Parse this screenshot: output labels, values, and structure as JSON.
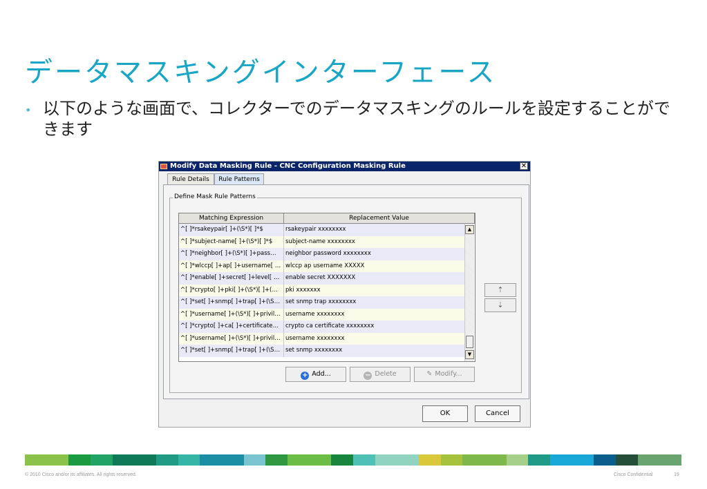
{
  "slide": {
    "title": "データマスキングインターフェース",
    "bullet_marker": "•",
    "bullet_text": "以下のような画面で、コレクターでのデータマスキングのルールを設定することができます"
  },
  "dialog": {
    "title": "Modify Data Masking Rule - CNC Configuration Masking Rule",
    "close_glyph": "✕",
    "tabs": [
      "Rule Details",
      "Rule Patterns"
    ],
    "active_tab": "Rule Patterns",
    "group_label": "Define Mask Rule Patterns",
    "columns": [
      "Matching Expression",
      "Replacement Value"
    ],
    "rows": [
      {
        "expr": "^[ ]*rsakeypair[ ]+(\\S*)[ ]*$",
        "value": "rsakeypair xxxxxxxx"
      },
      {
        "expr": "^[ ]*subject-name[ ]+(\\S*)[ ]*$",
        "value": "subject-name xxxxxxxx"
      },
      {
        "expr": "^[ ]*neighbor[ ]+(\\S*)[ ]+pass…",
        "value": "neighbor password xxxxxxxx"
      },
      {
        "expr": "^[ ]*wlccp[ ]+ap[ ]+username[ …",
        "value": "wlccp ap username XXXXX"
      },
      {
        "expr": "^[ ]*enable[ ]+secret[ ]+level[ …",
        "value": "enable secret XXXXXXX"
      },
      {
        "expr": "^[ ]*crypto[ ]+pki[ ]+(\\S*)[ ]+(…",
        "value": "pki xxxxxxx"
      },
      {
        "expr": "^[ ]*set[ ]+snmp[ ]+trap[ ]+(\\S…",
        "value": "set snmp trap xxxxxxxx"
      },
      {
        "expr": "^[ ]*username[ ]+(\\S*)[ ]+privil…",
        "value": "username xxxxxxxx"
      },
      {
        "expr": "^[ ]*crypto[ ]+ca[ ]+certificate…",
        "value": "crypto ca certificate xxxxxxxx"
      },
      {
        "expr": "^[ ]*username[ ]+(\\S*)[ ]+privil…",
        "value": "username xxxxxxxx"
      },
      {
        "expr": "^[ ]*set[ ]+snmp[ ]+trap[ ]+(\\S…",
        "value": "set snmp xxxxxxxx"
      }
    ],
    "scroll_up_glyph": "▲",
    "scroll_down_glyph": "▼",
    "move_up_glyph": "⇡",
    "move_down_glyph": "⇣",
    "buttons": {
      "add": "Add...",
      "delete": "Delete",
      "modify": "Modify...",
      "ok": "OK",
      "cancel": "Cancel"
    },
    "colors": {
      "row_even": "#e9e9f8",
      "row_odd": "#fbfbea",
      "titlebar": "#0a246a"
    }
  },
  "footer": {
    "copyright": "© 2010 Cisco and/or its affiliates. All rights reserved.",
    "confidential": "Cisco Confidential",
    "page": "19",
    "stripe_colors": [
      "#8bc34a",
      "#1a9b3f",
      "#21a366",
      "#0e7a58",
      "#1f9b83",
      "#35b5a5",
      "#1b8ea3",
      "#7ac4d2",
      "#2e9840",
      "#6cbd45",
      "#17853e",
      "#4fc0b5",
      "#8fd3c0",
      "#d8c83a",
      "#a6c13b",
      "#7fb84a",
      "#a6cf8a",
      "#1e9a86",
      "#18a8d8",
      "#0a5e8c",
      "#264f3a",
      "#6aa56f"
    ]
  }
}
